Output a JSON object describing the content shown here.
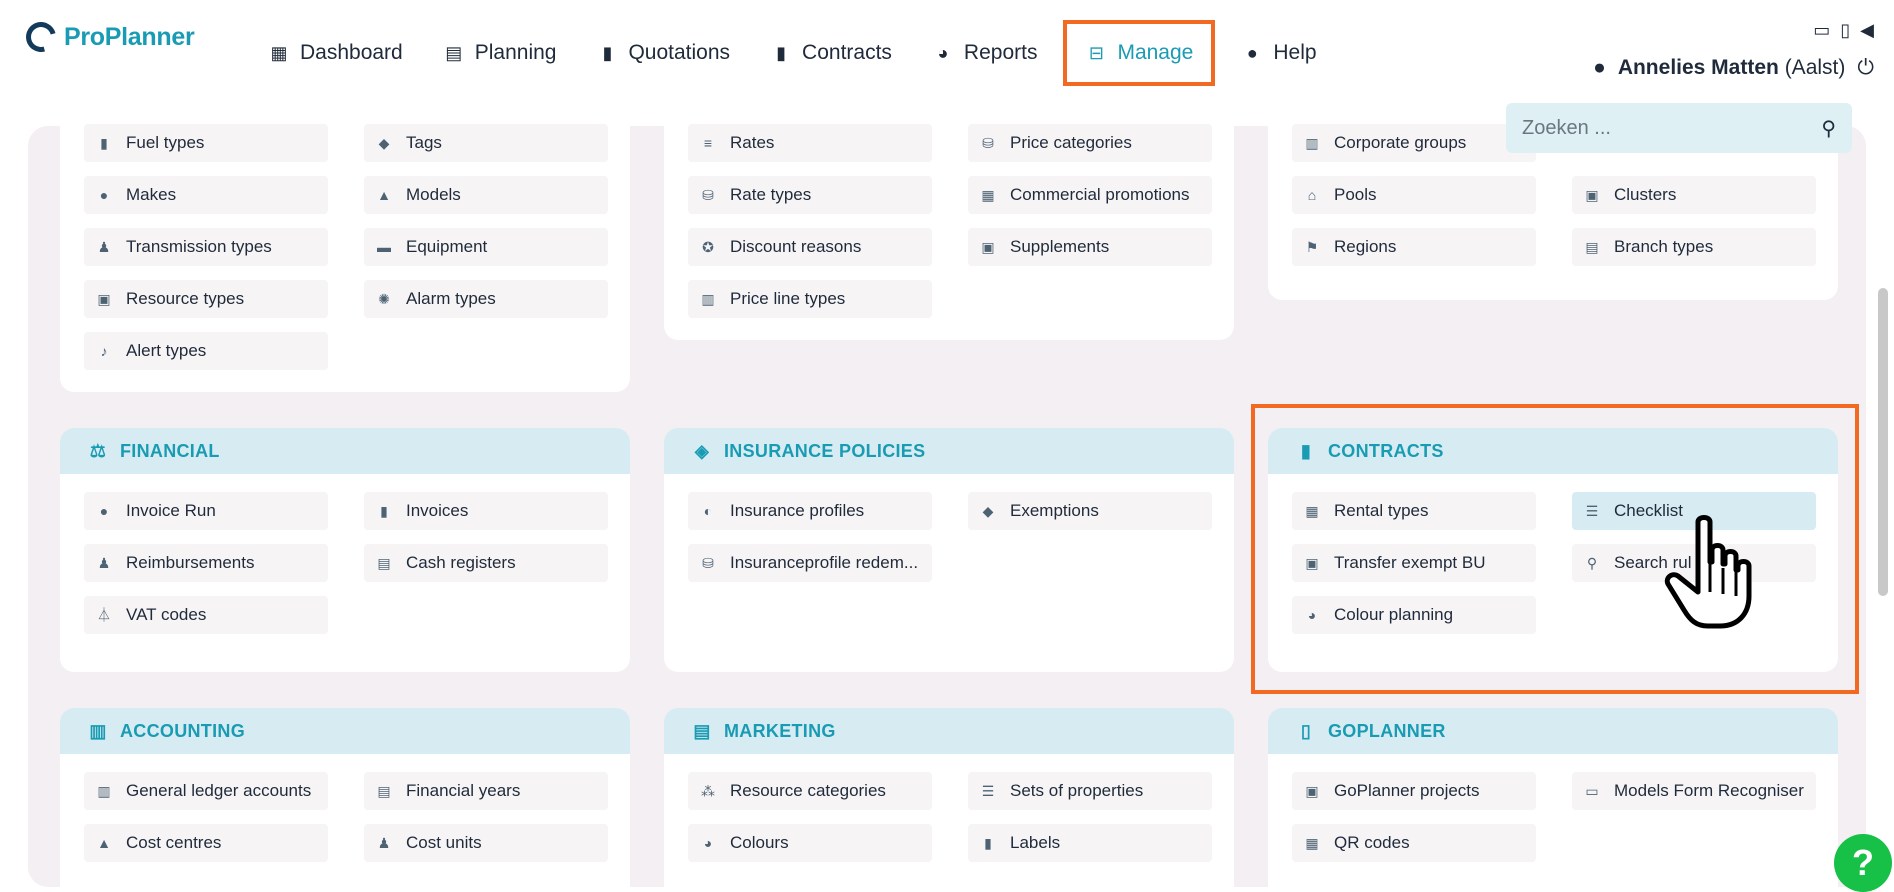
{
  "app": {
    "logo_prefix": "Pro",
    "logo_suffix": "Planner",
    "nav": [
      {
        "label": "Dashboard",
        "icon": "dashboard-icon",
        "glyph": "▦"
      },
      {
        "label": "Planning",
        "icon": "calendar-icon",
        "glyph": "▤"
      },
      {
        "label": "Quotations",
        "icon": "document-icon",
        "glyph": "▮"
      },
      {
        "label": "Contracts",
        "icon": "contract-icon",
        "glyph": "▮"
      },
      {
        "label": "Reports",
        "icon": "pie-chart-icon",
        "glyph": "◕"
      },
      {
        "label": "Manage",
        "icon": "manage-icon",
        "glyph": "⊟",
        "active": true
      },
      {
        "label": "Help",
        "icon": "help-icon",
        "glyph": "❓"
      }
    ],
    "user_name": "Annelies Matten",
    "user_location": "(Aalst)",
    "search_placeholder": "Zoeken ..."
  },
  "cards": {
    "vehicles": {
      "items": [
        "Fuel types",
        "Tags",
        "Makes",
        "Models",
        "Transmission types",
        "Equipment",
        "Resource types",
        "Alarm types",
        "Alert types"
      ]
    },
    "pricing": {
      "items": [
        "Rates",
        "Price categories",
        "Rate types",
        "Commercial promotions",
        "Discount reasons",
        "Supplements",
        "Price line types"
      ]
    },
    "organisation": {
      "items": [
        "Corporate groups",
        "Pools",
        "Clusters",
        "Regions",
        "Branch types"
      ]
    },
    "financial": {
      "title": "FINANCIAL",
      "items": [
        "Invoice Run",
        "Invoices",
        "Reimbursements",
        "Cash registers",
        "VAT codes"
      ]
    },
    "insurance": {
      "title": "INSURANCE POLICIES",
      "items": [
        "Insurance profiles",
        "Exemptions",
        "Insuranceprofile redem..."
      ]
    },
    "contracts": {
      "title": "CONTRACTS",
      "items": [
        "Rental types",
        "Checklist",
        "Transfer exempt BU",
        "Search rul",
        "Colour planning"
      ]
    },
    "accounting": {
      "title": "ACCOUNTING",
      "items": [
        "General ledger accounts",
        "Financial years",
        "Cost centres",
        "Cost units"
      ]
    },
    "marketing": {
      "title": "MARKETING",
      "items": [
        "Resource categories",
        "Sets of properties",
        "Colours",
        "Labels"
      ]
    },
    "goplanner": {
      "title": "GOPLANNER",
      "items": [
        "GoPlanner projects",
        "Models Form Recogniser",
        "QR codes"
      ]
    }
  },
  "help_fab": "?"
}
